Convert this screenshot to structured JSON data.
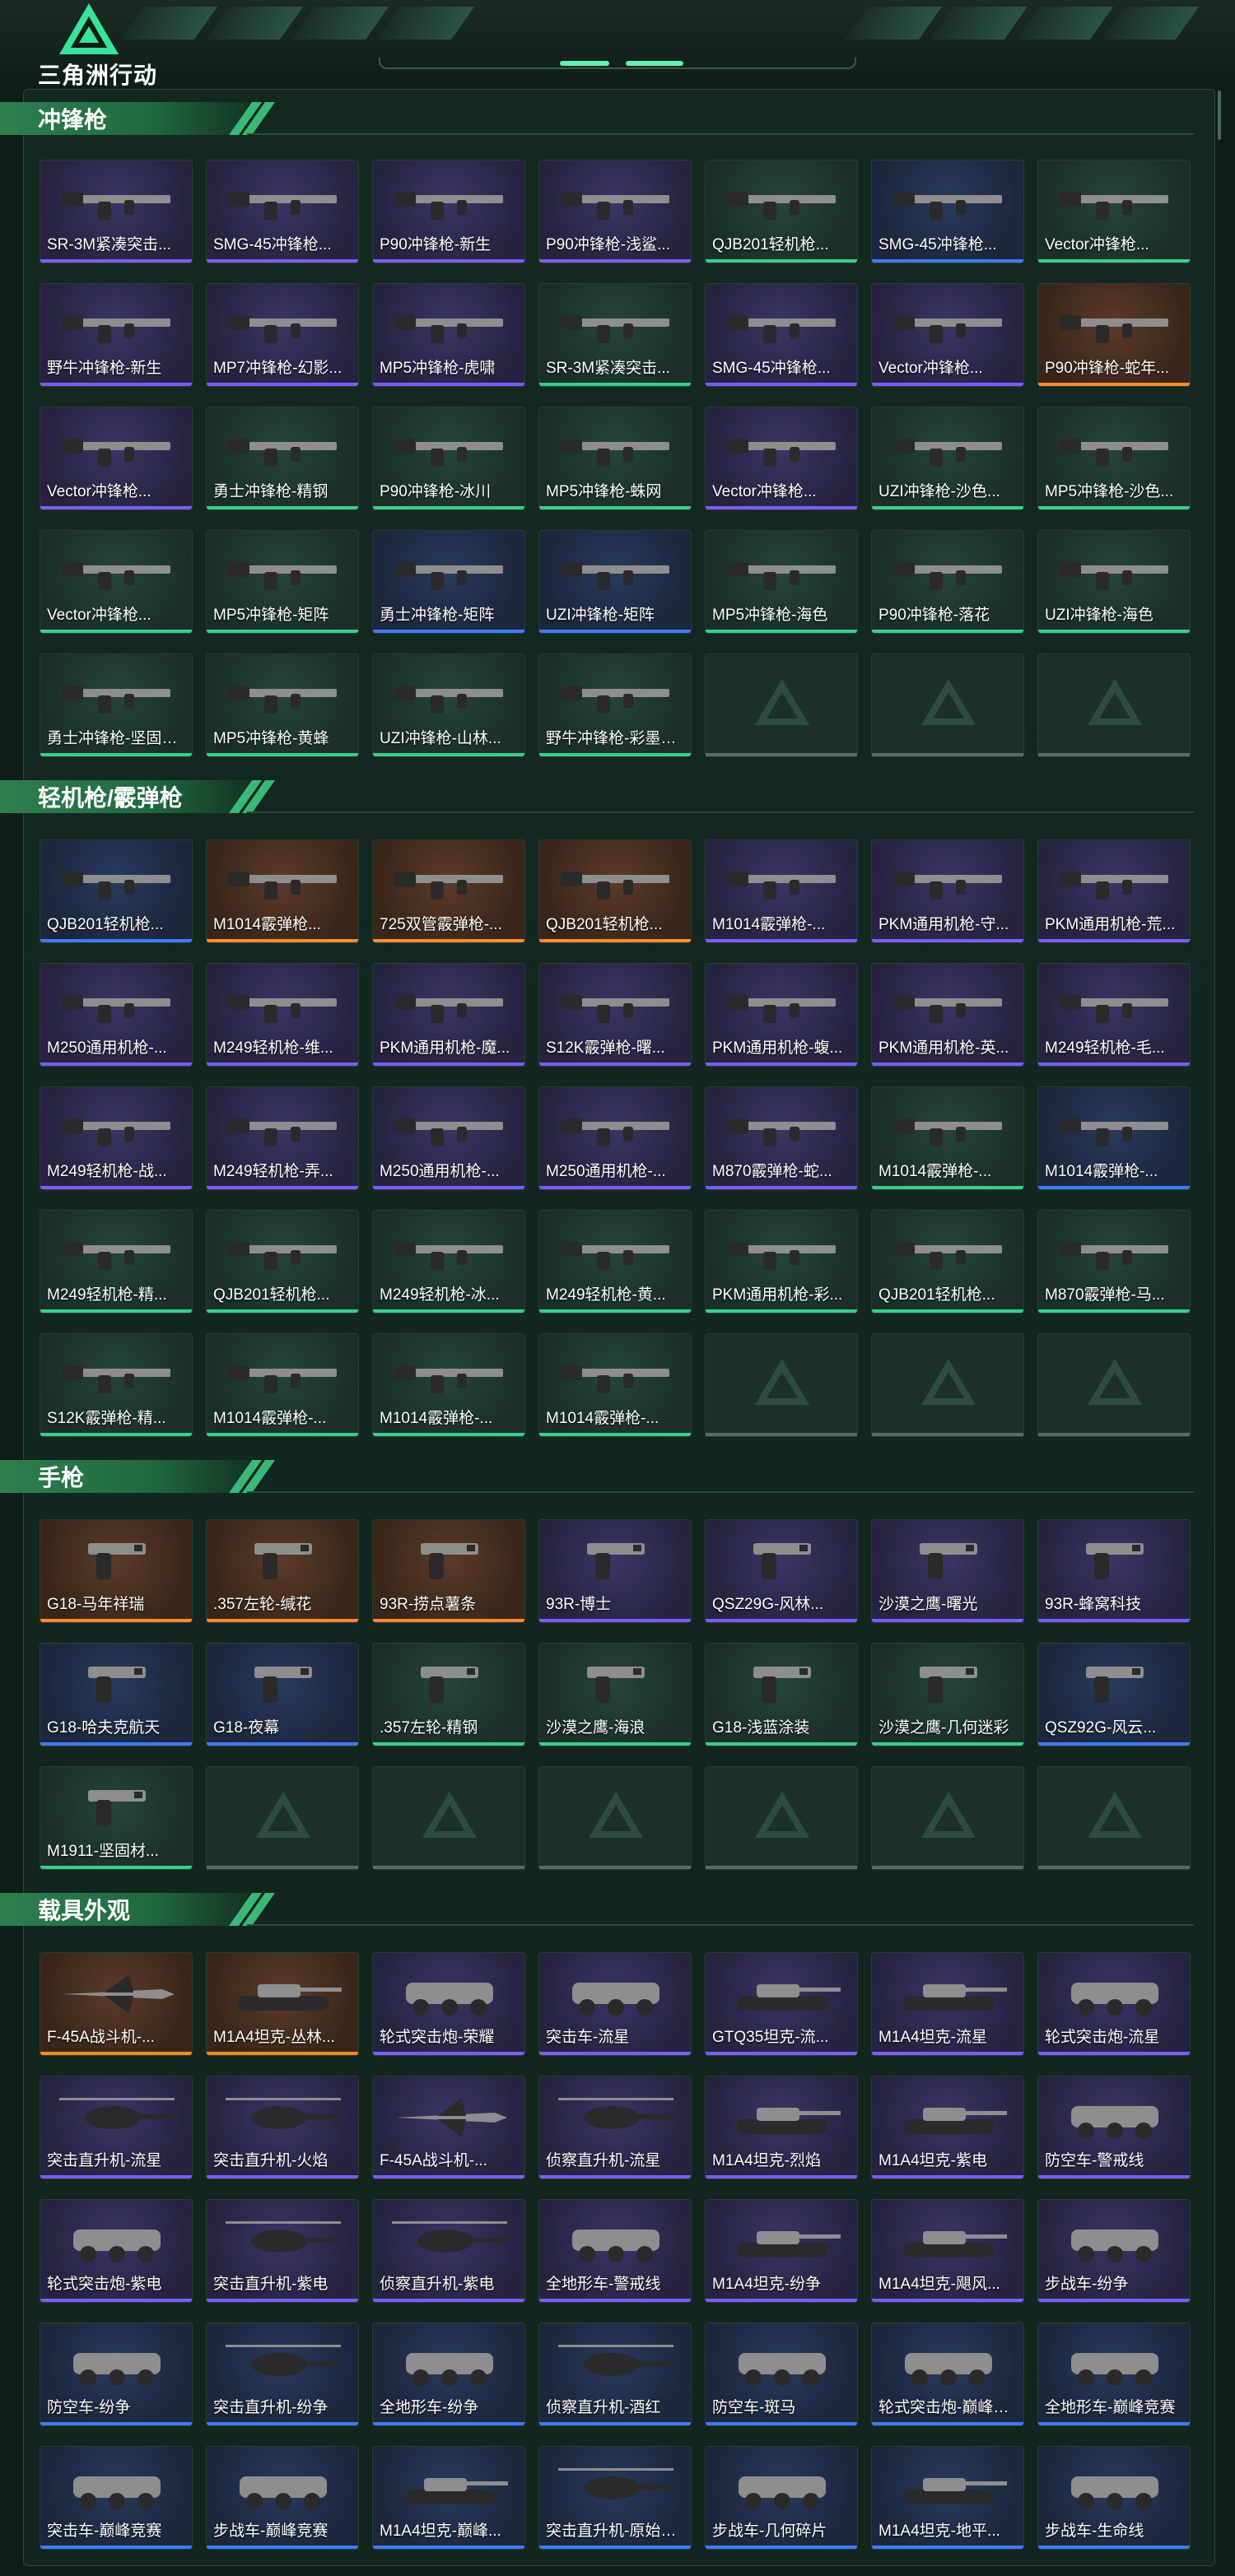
{
  "app": {
    "logo_text": "三角洲行动"
  },
  "sections": [
    {
      "title": "冲锋枪",
      "items": [
        {
          "name": "SR-3M紧凑突击...",
          "icon": "smg-icon",
          "rarity": "purple"
        },
        {
          "name": "SMG-45冲锋枪...",
          "icon": "smg-icon",
          "rarity": "purple"
        },
        {
          "name": "P90冲锋枪-新生",
          "icon": "smg-icon",
          "rarity": "purple"
        },
        {
          "name": "P90冲锋枪-浅鲨...",
          "icon": "smg-icon",
          "rarity": "purple"
        },
        {
          "name": "QJB201轻机枪...",
          "icon": "smg-icon",
          "rarity": "green"
        },
        {
          "name": "SMG-45冲锋枪...",
          "icon": "smg-icon",
          "rarity": "blue"
        },
        {
          "name": "Vector冲锋枪...",
          "icon": "smg-icon",
          "rarity": "green"
        },
        {
          "name": "野牛冲锋枪-新生",
          "icon": "smg-icon",
          "rarity": "purple"
        },
        {
          "name": "MP7冲锋枪-幻影...",
          "icon": "smg-icon",
          "rarity": "purple"
        },
        {
          "name": "MP5冲锋枪-虎啸",
          "icon": "smg-icon",
          "rarity": "purple"
        },
        {
          "name": "SR-3M紧凑突击...",
          "icon": "smg-icon",
          "rarity": "green"
        },
        {
          "name": "SMG-45冲锋枪...",
          "icon": "smg-icon",
          "rarity": "purple"
        },
        {
          "name": "Vector冲锋枪...",
          "icon": "smg-icon",
          "rarity": "purple"
        },
        {
          "name": "P90冲锋枪-蛇年...",
          "icon": "smg-icon",
          "rarity": "orange"
        },
        {
          "name": "Vector冲锋枪...",
          "icon": "smg-icon",
          "rarity": "purple"
        },
        {
          "name": "勇士冲锋枪-精钢",
          "icon": "smg-icon",
          "rarity": "green"
        },
        {
          "name": "P90冲锋枪-冰川",
          "icon": "smg-icon",
          "rarity": "green"
        },
        {
          "name": "MP5冲锋枪-蛛网",
          "icon": "smg-icon",
          "rarity": "green"
        },
        {
          "name": "Vector冲锋枪...",
          "icon": "smg-icon",
          "rarity": "purple"
        },
        {
          "name": "UZI冲锋枪-沙色...",
          "icon": "smg-icon",
          "rarity": "green"
        },
        {
          "name": "MP5冲锋枪-沙色...",
          "icon": "smg-icon",
          "rarity": "green"
        },
        {
          "name": "Vector冲锋枪...",
          "icon": "smg-icon",
          "rarity": "green"
        },
        {
          "name": "MP5冲锋枪-矩阵",
          "icon": "smg-icon",
          "rarity": "green"
        },
        {
          "name": "勇士冲锋枪-矩阵",
          "icon": "smg-icon",
          "rarity": "blue"
        },
        {
          "name": "UZI冲锋枪-矩阵",
          "icon": "smg-icon",
          "rarity": "blue"
        },
        {
          "name": "MP5冲锋枪-海色",
          "icon": "smg-icon",
          "rarity": "green"
        },
        {
          "name": "P90冲锋枪-落花",
          "icon": "smg-icon",
          "rarity": "green"
        },
        {
          "name": "UZI冲锋枪-海色",
          "icon": "smg-icon",
          "rarity": "green"
        },
        {
          "name": "勇士冲锋枪-坚固材...",
          "icon": "smg-icon",
          "rarity": "green"
        },
        {
          "name": "MP5冲锋枪-黄蜂",
          "icon": "smg-icon",
          "rarity": "green"
        },
        {
          "name": "UZI冲锋枪-山林...",
          "icon": "smg-icon",
          "rarity": "green"
        },
        {
          "name": "野牛冲锋枪-彩墨喷...",
          "icon": "smg-icon",
          "rarity": "green"
        }
      ],
      "empty_slots": 3
    },
    {
      "title": "轻机枪/霰弹枪",
      "items": [
        {
          "name": "QJB201轻机枪...",
          "icon": "lmg-icon",
          "rarity": "blue"
        },
        {
          "name": "M1014霰弹枪...",
          "icon": "shotgun-icon",
          "rarity": "orange"
        },
        {
          "name": "725双管霰弹枪-...",
          "icon": "shotgun-icon",
          "rarity": "orange"
        },
        {
          "name": "QJB201轻机枪...",
          "icon": "lmg-icon",
          "rarity": "orange"
        },
        {
          "name": "M1014霰弹枪-...",
          "icon": "shotgun-icon",
          "rarity": "purple"
        },
        {
          "name": "PKM通用机枪-守...",
          "icon": "lmg-icon",
          "rarity": "purple"
        },
        {
          "name": "PKM通用机枪-荒...",
          "icon": "lmg-icon",
          "rarity": "purple"
        },
        {
          "name": "M250通用机枪-...",
          "icon": "lmg-icon",
          "rarity": "purple"
        },
        {
          "name": "M249轻机枪-维...",
          "icon": "lmg-icon",
          "rarity": "purple"
        },
        {
          "name": "PKM通用机枪-魔...",
          "icon": "lmg-icon",
          "rarity": "purple"
        },
        {
          "name": "S12K霰弹枪-曙...",
          "icon": "shotgun-icon",
          "rarity": "purple"
        },
        {
          "name": "PKM通用机枪-蝮...",
          "icon": "lmg-icon",
          "rarity": "purple"
        },
        {
          "name": "PKM通用机枪-英...",
          "icon": "lmg-icon",
          "rarity": "purple"
        },
        {
          "name": "M249轻机枪-毛...",
          "icon": "lmg-icon",
          "rarity": "purple"
        },
        {
          "name": "M249轻机枪-战...",
          "icon": "lmg-icon",
          "rarity": "purple"
        },
        {
          "name": "M249轻机枪-弄...",
          "icon": "lmg-icon",
          "rarity": "purple"
        },
        {
          "name": "M250通用机枪-...",
          "icon": "lmg-icon",
          "rarity": "purple"
        },
        {
          "name": "M250通用机枪-...",
          "icon": "lmg-icon",
          "rarity": "purple"
        },
        {
          "name": "M870霰弹枪-蛇...",
          "icon": "shotgun-icon",
          "rarity": "purple"
        },
        {
          "name": "M1014霰弹枪-...",
          "icon": "shotgun-icon",
          "rarity": "green"
        },
        {
          "name": "M1014霰弹枪-...",
          "icon": "shotgun-icon",
          "rarity": "blue"
        },
        {
          "name": "M249轻机枪-精...",
          "icon": "lmg-icon",
          "rarity": "green"
        },
        {
          "name": "QJB201轻机枪...",
          "icon": "lmg-icon",
          "rarity": "green"
        },
        {
          "name": "M249轻机枪-冰...",
          "icon": "lmg-icon",
          "rarity": "green"
        },
        {
          "name": "M249轻机枪-黄...",
          "icon": "lmg-icon",
          "rarity": "green"
        },
        {
          "name": "PKM通用机枪-彩...",
          "icon": "lmg-icon",
          "rarity": "green"
        },
        {
          "name": "QJB201轻机枪...",
          "icon": "lmg-icon",
          "rarity": "green"
        },
        {
          "name": "M870霰弹枪-马...",
          "icon": "shotgun-icon",
          "rarity": "green"
        },
        {
          "name": "S12K霰弹枪-精...",
          "icon": "shotgun-icon",
          "rarity": "green"
        },
        {
          "name": "M1014霰弹枪-...",
          "icon": "shotgun-icon",
          "rarity": "green"
        },
        {
          "name": "M1014霰弹枪-...",
          "icon": "shotgun-icon",
          "rarity": "green"
        },
        {
          "name": "M1014霰弹枪-...",
          "icon": "shotgun-icon",
          "rarity": "green"
        }
      ],
      "empty_slots": 3
    },
    {
      "title": "手枪",
      "items": [
        {
          "name": "G18-马年祥瑞",
          "icon": "pistol-icon",
          "rarity": "orange"
        },
        {
          "name": ".357左轮-缄花",
          "icon": "revolver-icon",
          "rarity": "orange"
        },
        {
          "name": "93R-捞点薯条",
          "icon": "pistol-icon",
          "rarity": "orange"
        },
        {
          "name": "93R-博士",
          "icon": "pistol-icon",
          "rarity": "purple"
        },
        {
          "name": "QSZ29G-风林...",
          "icon": "pistol-icon",
          "rarity": "purple"
        },
        {
          "name": "沙漠之鹰-曙光",
          "icon": "pistol-icon",
          "rarity": "purple"
        },
        {
          "name": "93R-蜂窝科技",
          "icon": "pistol-icon",
          "rarity": "purple"
        },
        {
          "name": "G18-哈夫克航天",
          "icon": "pistol-icon",
          "rarity": "blue"
        },
        {
          "name": "G18-夜幕",
          "icon": "pistol-icon",
          "rarity": "blue"
        },
        {
          "name": ".357左轮-精钢",
          "icon": "revolver-icon",
          "rarity": "green"
        },
        {
          "name": "沙漠之鹰-海浪",
          "icon": "pistol-icon",
          "rarity": "green"
        },
        {
          "name": "G18-浅蓝涂装",
          "icon": "pistol-icon",
          "rarity": "green"
        },
        {
          "name": "沙漠之鹰-几何迷彩",
          "icon": "pistol-icon",
          "rarity": "green"
        },
        {
          "name": "QSZ92G-风云...",
          "icon": "pistol-icon",
          "rarity": "blue"
        },
        {
          "name": "M1911-坚固材...",
          "icon": "pistol-icon",
          "rarity": "green"
        }
      ],
      "empty_slots": 6
    },
    {
      "title": "载具外观",
      "items": [
        {
          "name": "F-45A战斗机-...",
          "icon": "jet-icon",
          "rarity": "orange"
        },
        {
          "name": "M1A4坦克-丛林...",
          "icon": "tank-icon",
          "rarity": "orange"
        },
        {
          "name": "轮式突击炮-荣耀",
          "icon": "armored-car-icon",
          "rarity": "purple"
        },
        {
          "name": "突击车-流星",
          "icon": "assault-vehicle-icon",
          "rarity": "purple"
        },
        {
          "name": "GTQ35坦克-流...",
          "icon": "tank-icon",
          "rarity": "purple"
        },
        {
          "name": "M1A4坦克-流星",
          "icon": "tank-icon",
          "rarity": "purple"
        },
        {
          "name": "轮式突击炮-流星",
          "icon": "armored-car-icon",
          "rarity": "purple"
        },
        {
          "name": "突击直升机-流星",
          "icon": "helicopter-icon",
          "rarity": "purple"
        },
        {
          "name": "突击直升机-火焰",
          "icon": "helicopter-icon",
          "rarity": "purple"
        },
        {
          "name": "F-45A战斗机-...",
          "icon": "jet-icon",
          "rarity": "purple"
        },
        {
          "name": "侦察直升机-流星",
          "icon": "helicopter-icon",
          "rarity": "purple"
        },
        {
          "name": "M1A4坦克-烈焰",
          "icon": "tank-icon",
          "rarity": "purple"
        },
        {
          "name": "M1A4坦克-紫电",
          "icon": "tank-icon",
          "rarity": "purple"
        },
        {
          "name": "防空车-警戒线",
          "icon": "anti-air-vehicle-icon",
          "rarity": "purple"
        },
        {
          "name": "轮式突击炮-紫电",
          "icon": "armored-car-icon",
          "rarity": "purple"
        },
        {
          "name": "突击直升机-紫电",
          "icon": "helicopter-icon",
          "rarity": "purple"
        },
        {
          "name": "侦察直升机-紫电",
          "icon": "helicopter-icon",
          "rarity": "purple"
        },
        {
          "name": "全地形车-警戒线",
          "icon": "atv-icon",
          "rarity": "purple"
        },
        {
          "name": "M1A4坦克-纷争",
          "icon": "tank-icon",
          "rarity": "purple"
        },
        {
          "name": "M1A4坦克-飓风...",
          "icon": "tank-icon",
          "rarity": "purple"
        },
        {
          "name": "步战车-纷争",
          "icon": "ifv-icon",
          "rarity": "purple"
        },
        {
          "name": "防空车-纷争",
          "icon": "anti-air-vehicle-icon",
          "rarity": "blue"
        },
        {
          "name": "突击直升机-纷争",
          "icon": "helicopter-icon",
          "rarity": "blue"
        },
        {
          "name": "全地形车-纷争",
          "icon": "atv-icon",
          "rarity": "blue"
        },
        {
          "name": "侦察直升机-酒红",
          "icon": "helicopter-icon",
          "rarity": "blue"
        },
        {
          "name": "防空车-斑马",
          "icon": "anti-air-vehicle-icon",
          "rarity": "blue"
        },
        {
          "name": "轮式突击炮-巅峰竞...",
          "icon": "armored-car-icon",
          "rarity": "blue"
        },
        {
          "name": "全地形车-巅峰竞赛",
          "icon": "atv-icon",
          "rarity": "blue"
        },
        {
          "name": "突击车-巅峰竞赛",
          "icon": "assault-vehicle-icon",
          "rarity": "blue"
        },
        {
          "name": "步战车-巅峰竞赛",
          "icon": "ifv-icon",
          "rarity": "blue"
        },
        {
          "name": "M1A4坦克-巅峰...",
          "icon": "tank-icon",
          "rarity": "blue"
        },
        {
          "name": "突击直升机-原始伪...",
          "icon": "helicopter-icon",
          "rarity": "blue"
        },
        {
          "name": "步战车-几何碎片",
          "icon": "ifv-icon",
          "rarity": "blue"
        },
        {
          "name": "M1A4坦克-地平...",
          "icon": "tank-icon",
          "rarity": "blue"
        },
        {
          "name": "步战车-生命线",
          "icon": "ifv-icon",
          "rarity": "blue"
        }
      ],
      "empty_slots": 0
    }
  ],
  "colors": {
    "accent": "#33d18a",
    "rarity_purple": "#7b5cff",
    "rarity_blue": "#3a7cff",
    "rarity_green": "#33d18a",
    "rarity_orange": "#ff8a2a"
  }
}
